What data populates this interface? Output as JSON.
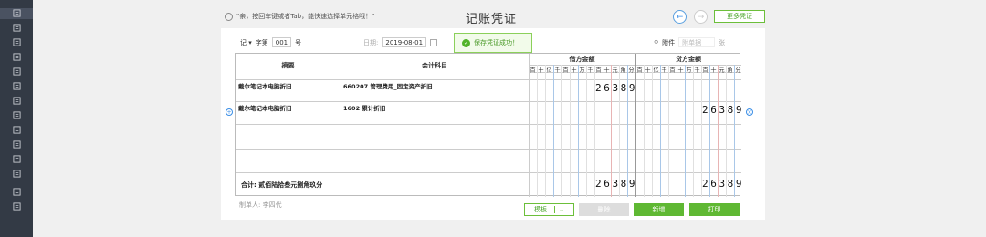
{
  "sidebar": {
    "items": [
      {
        "icon": "doc-icon"
      },
      {
        "icon": "upload-icon"
      },
      {
        "icon": "chart-icon"
      },
      {
        "icon": "book-icon"
      },
      {
        "icon": "report-icon"
      },
      {
        "icon": "ledger-icon"
      },
      {
        "icon": "list-icon"
      },
      {
        "icon": "money-icon"
      },
      {
        "icon": "stack-icon"
      },
      {
        "icon": "audit-icon"
      },
      {
        "icon": "mail-icon"
      },
      {
        "icon": "settings-icon"
      },
      {
        "icon": "export-icon"
      },
      {
        "icon": "sign-icon"
      }
    ]
  },
  "header": {
    "tip": "\"亲，按回车键或者Tab，能快速选择单元格哦！\"",
    "title": "记账凭证",
    "prev_icon": "←",
    "next_icon": "→",
    "more_label": "更多凭证"
  },
  "voucher": {
    "word": "记",
    "word_suffix": "字第",
    "number": "001",
    "number_suffix": "号",
    "date_label": "日期:",
    "date": "2019-08-01",
    "attach_label": "附件",
    "attach_placeholder": "附单据",
    "attach_unit": "张"
  },
  "toast": {
    "text": "保存凭证成功！"
  },
  "table": {
    "col_summary": "摘要",
    "col_account": "会计科目",
    "col_debit": "借方金额",
    "col_credit": "贷方金额",
    "units": [
      "百",
      "十",
      "亿",
      "千",
      "百",
      "十",
      "万",
      "千",
      "百",
      "十",
      "元",
      "角",
      "分"
    ],
    "rows": [
      {
        "summary": "戴尔笔记本电脑折旧",
        "account": "660207 管理费用_固定资产折旧",
        "debit": "26389",
        "credit": ""
      },
      {
        "summary": "戴尔笔记本电脑折旧",
        "account": "1602 累计折旧",
        "debit": "",
        "credit": "26389"
      },
      {
        "summary": "",
        "account": "",
        "debit": "",
        "credit": ""
      },
      {
        "summary": "",
        "account": "",
        "debit": "",
        "credit": ""
      }
    ],
    "total_label": "合计:  贰佰陆拾叁元捌角玖分",
    "total_debit": "26389",
    "total_credit": "26389"
  },
  "footer": {
    "maker": "制单人: 李四代",
    "template_label": "模板",
    "delete_label": "删除",
    "new_label": "新增",
    "print_label": "打印"
  },
  "colors": {
    "accent_green": "#6cbf3a",
    "accent_blue": "#3a8ee6",
    "sidebar_bg": "#333a45"
  }
}
